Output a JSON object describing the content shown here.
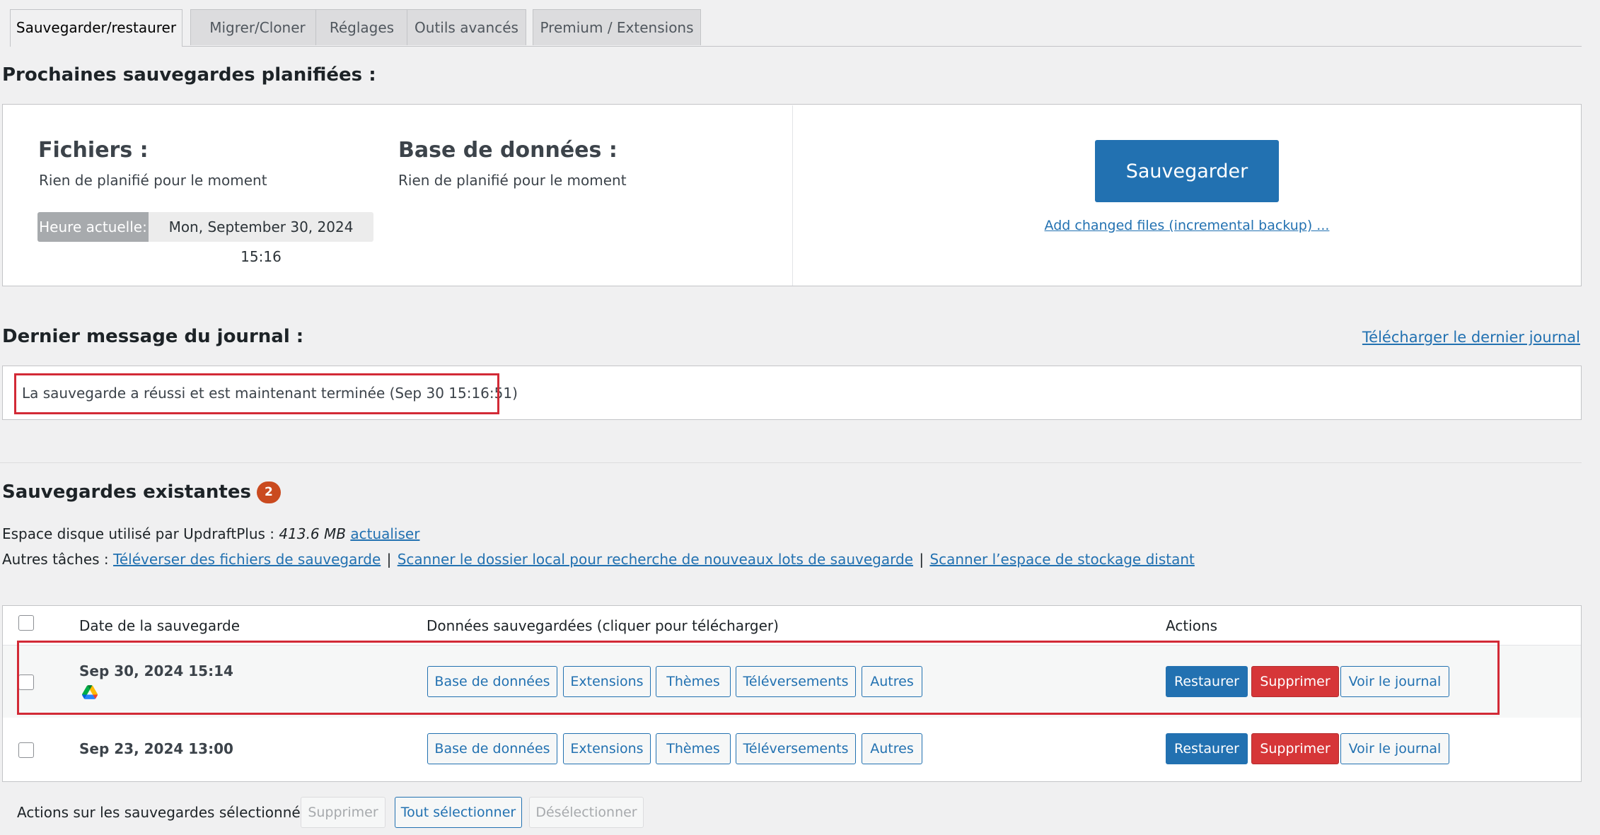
{
  "tabs": [
    {
      "label": "Sauvegarder/restaurer",
      "active": true
    },
    {
      "label": "Migrer/Cloner",
      "active": false
    },
    {
      "label": "Réglages",
      "active": false
    },
    {
      "label": "Outils avancés",
      "active": false
    },
    {
      "label": "Premium / Extensions",
      "active": false
    }
  ],
  "scheduled": {
    "heading": "Prochaines sauvegardes planifiées :",
    "files_title": "Fichiers :",
    "files_status": "Rien de planifié pour le moment",
    "db_title": "Base de données :",
    "db_status": "Rien de planifié pour le moment",
    "current_time_label": "Heure actuelle:",
    "current_time_value": "Mon, September 30, 2024 15:16",
    "backup_button": "Sauvegarder",
    "incremental_link": "Add changed files (incremental backup) ..."
  },
  "log": {
    "heading": "Dernier message du journal :",
    "download_link": "Télécharger le dernier journal",
    "message": "La sauvegarde a réussi et est maintenant terminée (Sep 30 15:16:51)"
  },
  "existing": {
    "heading": "Sauvegardes existantes",
    "count": "2",
    "disk_label": "Espace disque utilisé par UpdraftPlus :",
    "disk_value": "413.6 MB",
    "refresh_link": "actualiser",
    "other_tasks_label": "Autres tâches :",
    "task_upload": "Téléverser des fichiers de sauvegarde",
    "task_scan_local": "Scanner le dossier local pour recherche de nouveaux lots de sauvegarde",
    "task_scan_remote": "Scanner l’espace de stockage distant",
    "separator": "|"
  },
  "table": {
    "col_date": "Date de la sauvegarde",
    "col_data": "Données sauvegardées (cliquer pour télécharger)",
    "col_actions": "Actions",
    "rows": [
      {
        "date": "Sep 30, 2024 15:14",
        "storage_icon": "google-drive-icon",
        "data_buttons": [
          "Base de données",
          "Extensions",
          "Thèmes",
          "Téléversements",
          "Autres"
        ],
        "restore": "Restaurer",
        "delete": "Supprimer",
        "view_log": "Voir le journal"
      },
      {
        "date": "Sep 23, 2024 13:00",
        "data_buttons": [
          "Base de données",
          "Extensions",
          "Thèmes",
          "Téléversements",
          "Autres"
        ],
        "restore": "Restaurer",
        "delete": "Supprimer",
        "view_log": "Voir le journal"
      }
    ]
  },
  "bulk": {
    "label": "Actions sur les sauvegardes sélectionnées",
    "delete": "Supprimer",
    "select_all": "Tout sélectionner",
    "deselect": "Désélectionner"
  },
  "colors": {
    "primary": "#2271b1",
    "danger": "#d63638",
    "badge": "#ca4a1f",
    "highlight_box": "#d22a36"
  }
}
